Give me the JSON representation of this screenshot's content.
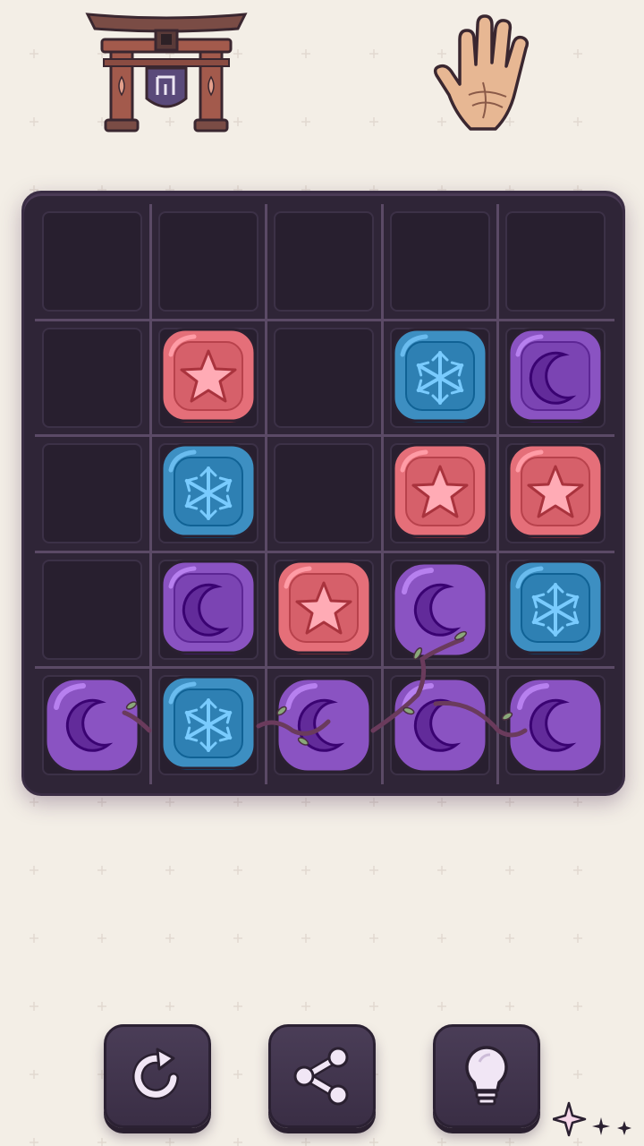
{
  "header": {
    "left_icon": "torii-gate-shield-icon",
    "right_icon": "palm-hand-icon"
  },
  "board": {
    "rows": 5,
    "cols": 5,
    "tiles": [
      [
        null,
        null,
        null,
        null,
        null
      ],
      [
        null,
        "star",
        null,
        "snowflake",
        "moon"
      ],
      [
        null,
        "snowflake",
        null,
        "star",
        "star"
      ],
      [
        null,
        "moon",
        "star",
        "moon",
        "snowflake"
      ],
      [
        "moon",
        "snowflake",
        "moon",
        "moon",
        "moon"
      ]
    ],
    "vine_bound": [
      [
        3,
        3
      ],
      [
        4,
        0
      ],
      [
        4,
        2
      ],
      [
        4,
        3
      ],
      [
        4,
        4
      ]
    ],
    "tile_colors": {
      "star": "#e56f79",
      "snowflake": "#3d8fc2",
      "moon": "#8a53c2"
    }
  },
  "controls": [
    {
      "name": "restart-button",
      "icon": "restart-arrow-icon"
    },
    {
      "name": "share-button",
      "icon": "share-icon"
    },
    {
      "name": "hint-button",
      "icon": "lightbulb-icon"
    }
  ],
  "decoration": "sparkle-icon"
}
